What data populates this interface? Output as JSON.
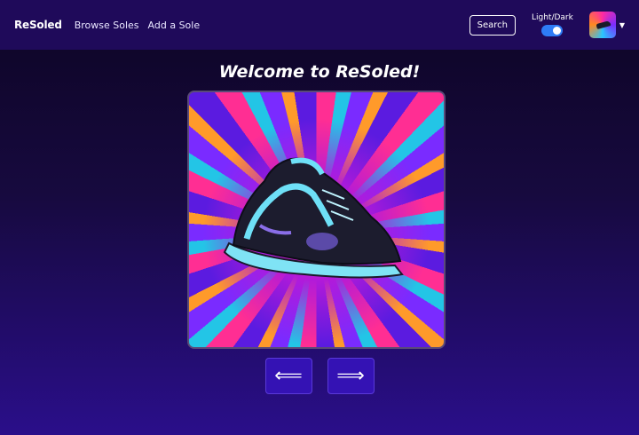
{
  "navbar": {
    "brand": "ReSoled",
    "links": [
      "Browse Soles",
      "Add a Sole"
    ],
    "search_label": "Search",
    "theme_toggle_label": "Light/Dark",
    "theme_toggle_on": true
  },
  "main": {
    "title": "Welcome to ReSoled!",
    "prev_arrow": "⟸",
    "next_arrow": "⟹"
  },
  "colors": {
    "navbar_bg": "#1f0a5a",
    "accent": "#3412b4",
    "toggle": "#2e7cf6"
  },
  "icons": [
    "avatar-image",
    "caret-down-icon",
    "sneaker-image",
    "left-arrow-icon",
    "right-arrow-icon"
  ]
}
